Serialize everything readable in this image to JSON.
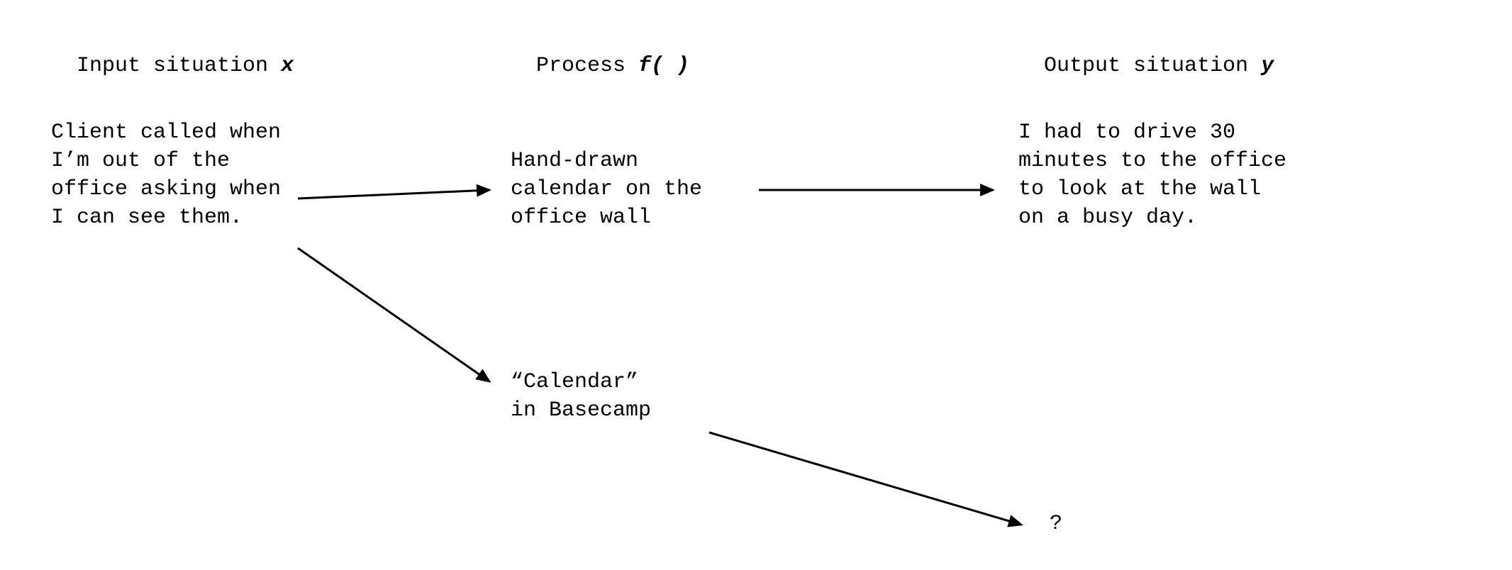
{
  "headers": {
    "input": {
      "label": "Input situation ",
      "var": "x"
    },
    "process": {
      "label": "Process ",
      "var": "f( )"
    },
    "output": {
      "label": "Output situation ",
      "var": "y"
    }
  },
  "nodes": {
    "input_text": "Client called when I’m out of the office asking when I can see them.",
    "process_top": "Hand-drawn calendar on the office wall",
    "process_bottom": "“Calendar”\nin Basecamp",
    "output_top": "I had to drive 30 minutes to the office to look at the wall on a busy day.",
    "output_bottom": "?"
  }
}
